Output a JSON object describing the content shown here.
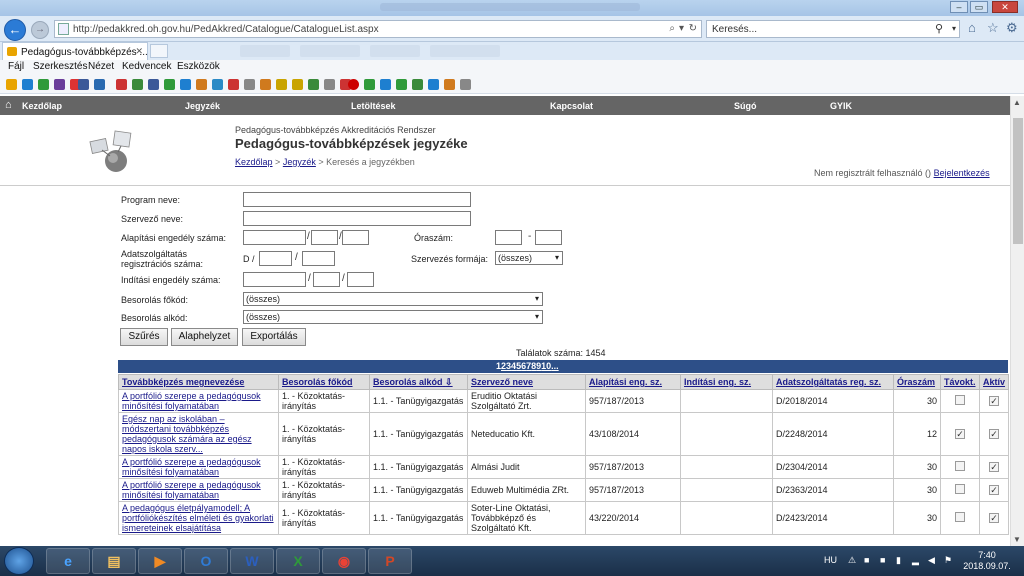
{
  "browser": {
    "url": "http://pedakkred.oh.gov.hu/PedAkkred/Catalogue/CatalogueList.aspx",
    "search_placeholder": "Keresés...",
    "tab_title": "Pedagógus-továbbképzés ...",
    "menu": [
      "Fájl",
      "Szerkesztés",
      "Nézet",
      "Kedvencek",
      "Eszközök"
    ]
  },
  "site_nav": [
    "Kezdőlap",
    "Jegyzék",
    "Letöltések",
    "Kapcsolat",
    "Súgó",
    "GYIK"
  ],
  "header": {
    "subtitle": "Pedagógus-továbbképzés Akkreditációs Rendszer",
    "title": "Pedagógus-továbbképzések jegyzéke",
    "breadcrumb": [
      "Kezdőlap",
      "Jegyzék",
      "Keresés a jegyzékben"
    ],
    "user_status": "Nem regisztrált felhasználó ()",
    "login_link": "Bejelentkezés"
  },
  "form": {
    "program_label": "Program neve:",
    "organizer_label": "Szervező neve:",
    "founding_label": "Alapítási engedély száma:",
    "hours_label": "Óraszám:",
    "hours_sep": "-",
    "registry_label_1": "Adatszolgáltatás",
    "registry_label_2": "regisztrációs száma:",
    "registry_prefix": "D /",
    "slash": "/",
    "org_form_label": "Szervezés formája:",
    "org_form_value": "(összes)",
    "start_label": "Indítási engedély száma:",
    "main_code_label": "Besorolás főkód:",
    "main_code_value": "(összes)",
    "sub_code_label": "Besorolás alkód:",
    "sub_code_value": "(összes)",
    "buttons": [
      "Szűrés",
      "Alaphelyzet",
      "Exportálás"
    ]
  },
  "results": {
    "count_text": "Találatok száma: 1454",
    "current_page": "1",
    "pages": [
      "2",
      "3",
      "4",
      "5",
      "6",
      "7",
      "8",
      "9",
      "10",
      "..."
    ]
  },
  "table": {
    "headers": [
      "Továbbképzés megnevezése",
      "Besorolás főkód",
      "Besorolás alkód",
      "Szervező neve",
      "Alapítási eng. sz.",
      "Indítási eng. sz.",
      "Adatszolgáltatás reg. sz.",
      "Óraszám",
      "Távokt.",
      "Aktív"
    ],
    "sort_indicator": "⇩",
    "rows": [
      {
        "name": "A portfólió szerepe a pedagógusok minősítési folyamatában",
        "main": "1. - Közoktatás-irányítás",
        "sub": "1.1. - Tanügyigazgatás",
        "org": "Eruditio Oktatási Szolgáltató Zrt.",
        "found": "957/187/2013",
        "start": "",
        "reg": "D/2018/2014",
        "hours": "30",
        "distance": false,
        "active": true
      },
      {
        "name": "Egész nap az iskolában – módszertani továbbképzés pedagógusok számára az egész napos iskola szerv...",
        "main": "1. - Közoktatás-irányítás",
        "sub": "1.1. - Tanügyigazgatás",
        "org": "Neteducatio Kft.",
        "found": "43/108/2014",
        "start": "",
        "reg": "D/2248/2014",
        "hours": "12",
        "distance": true,
        "active": true
      },
      {
        "name": "A portfólió szerepe a pedagógusok minősítési folyamatában",
        "main": "1. - Közoktatás-irányítás",
        "sub": "1.1. - Tanügyigazgatás",
        "org": "Almási Judit",
        "found": "957/187/2013",
        "start": "",
        "reg": "D/2304/2014",
        "hours": "30",
        "distance": false,
        "active": true
      },
      {
        "name": "A portfólió szerepe a pedagógusok minősítési folyamatában",
        "main": "1. - Közoktatás-irányítás",
        "sub": "1.1. - Tanügyigazgatás",
        "org": "Eduweb Multimédia ZRt.",
        "found": "957/187/2013",
        "start": "",
        "reg": "D/2363/2014",
        "hours": "30",
        "distance": false,
        "active": true
      },
      {
        "name": "A pedagógus életpályamodell; A portfóliókészítés elméleti és gyakorlati ismereteinek elsajátítása",
        "main": "1. - Közoktatás-irányítás",
        "sub": "1.1. - Tanügyigazgatás",
        "org": "Soter-Line Oktatási, Továbbképző és Szolgáltató Kft.",
        "found": "43/220/2014",
        "start": "",
        "reg": "D/2423/2014",
        "hours": "30",
        "distance": false,
        "active": true
      }
    ]
  },
  "taskbar": {
    "lang": "HU",
    "time": "7:40",
    "date": "2018.09.07."
  },
  "colors": {
    "site_nav_bg": "#656565",
    "pager_bg": "#2d4f88",
    "link": "#1a1a8a"
  }
}
